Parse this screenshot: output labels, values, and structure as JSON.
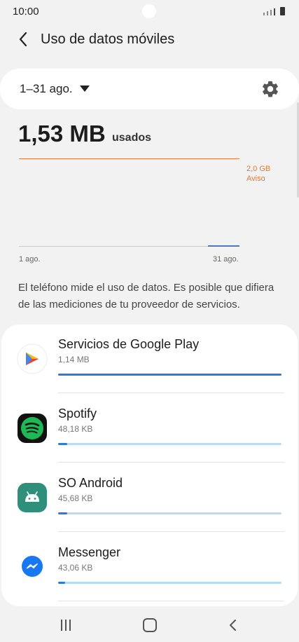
{
  "status": {
    "time": "10:00"
  },
  "header": {
    "title": "Uso de datos móviles"
  },
  "range": {
    "label": "1–31 ago."
  },
  "usage": {
    "value": "1,53 MB",
    "unit": "usados"
  },
  "chart": {
    "warning_amount": "2,0 GB",
    "warning_label": "Aviso",
    "x_start": "1 ago.",
    "x_end": "31 ago."
  },
  "disclaimer": "El teléfono mide el uso de datos. Es posible que difiera de las mediciones de tu proveedor de servicios.",
  "apps": [
    {
      "name": "Servicios de Google Play",
      "size": "1,14 MB",
      "fraction": 1.0,
      "icon": "google-play-services-icon"
    },
    {
      "name": "Spotify",
      "size": "48,18 KB",
      "fraction": 0.04,
      "icon": "spotify-icon"
    },
    {
      "name": "SO Android",
      "size": "45,68 KB",
      "fraction": 0.04,
      "icon": "android-icon"
    },
    {
      "name": "Messenger",
      "size": "43,06 KB",
      "fraction": 0.03,
      "icon": "messenger-icon"
    }
  ],
  "colors": {
    "accent": "#2e7bd6",
    "warning": "#e7782f",
    "spotify": "#1db954",
    "android": "#2e8f7a",
    "messenger": "#1877f2"
  }
}
